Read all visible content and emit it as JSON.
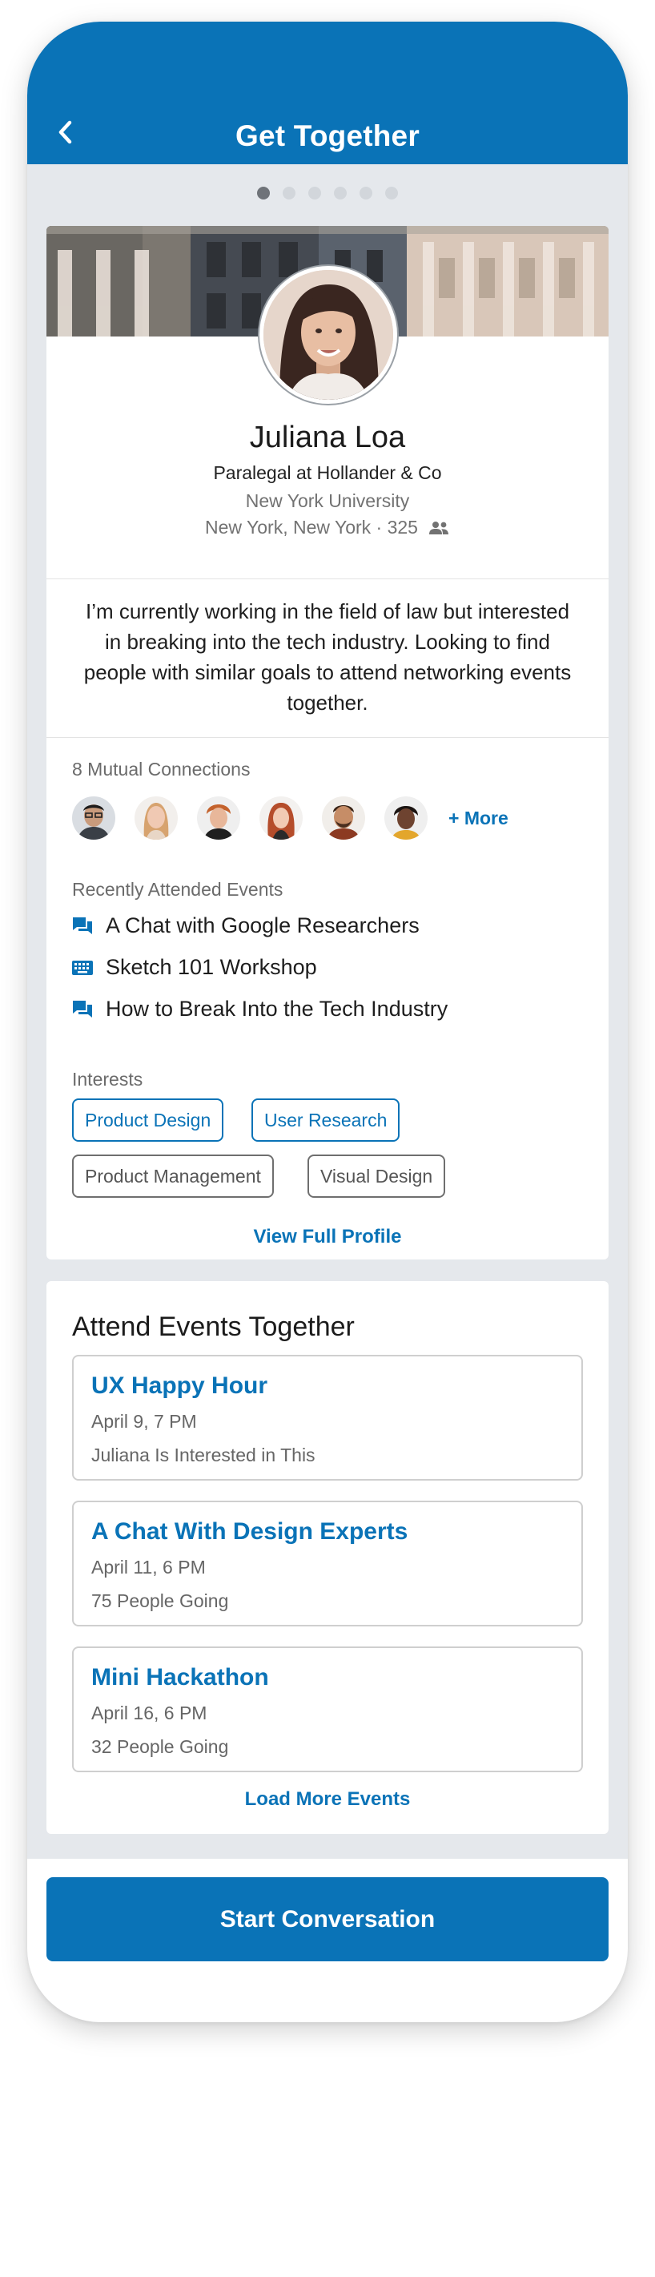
{
  "header": {
    "title": "Get Together"
  },
  "pager": {
    "total": 6,
    "active": 0
  },
  "profile": {
    "name": "Juliana Loa",
    "headline": "Paralegal at Hollander & Co",
    "school": "New York University",
    "location": "New York, New York · 325",
    "bio": "I’m currently working in the field of law but interested in breaking into the tech industry. Looking to find people with similar goals to attend networking events together.",
    "mutual_label": "8 Mutual Connections",
    "more_label": "+ More",
    "recent_label": "Recently Attended Events",
    "recent_events": [
      {
        "icon": "chat-icon",
        "title": "A Chat with Google Researchers"
      },
      {
        "icon": "keyboard-icon",
        "title": "Sketch 101 Workshop"
      },
      {
        "icon": "chat-icon",
        "title": "How to Break Into the Tech Industry"
      }
    ],
    "interests_label": "Interests",
    "interests": [
      {
        "label": "Product Design",
        "style": "shared"
      },
      {
        "label": "User Research",
        "style": "shared"
      },
      {
        "label": "Product Management",
        "style": "other"
      },
      {
        "label": "Visual Design",
        "style": "other"
      }
    ],
    "view_full": "View Full Profile"
  },
  "events": {
    "title": "Attend Events Together",
    "items": [
      {
        "title": "UX Happy Hour",
        "date": "April 9, 7 PM",
        "status": "Juliana Is Interested in This"
      },
      {
        "title": "A Chat With Design Experts",
        "date": "April 11, 6 PM",
        "status": "75 People Going"
      },
      {
        "title": "Mini Hackathon",
        "date": "April 16, 6 PM",
        "status": "32 People Going"
      }
    ],
    "load_more": "Load More Events"
  },
  "cta": {
    "label": "Start Conversation"
  },
  "colors": {
    "brand": "#0a73b7",
    "background": "#e5e8ec"
  }
}
